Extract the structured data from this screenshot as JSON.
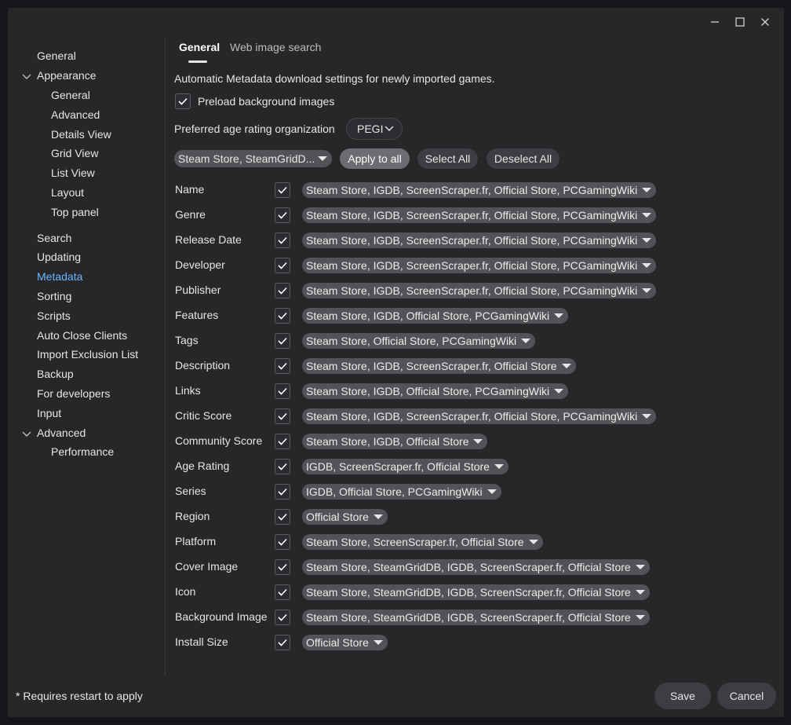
{
  "sidebar": {
    "items": [
      {
        "label": "General",
        "indent": 0
      },
      {
        "label": "Appearance",
        "indent": 0,
        "expanded": true
      },
      {
        "label": "General",
        "indent": 1
      },
      {
        "label": "Advanced",
        "indent": 1
      },
      {
        "label": "Details View",
        "indent": 1
      },
      {
        "label": "Grid View",
        "indent": 1
      },
      {
        "label": "List View",
        "indent": 1
      },
      {
        "label": "Layout",
        "indent": 1
      },
      {
        "label": "Top panel",
        "indent": 1
      },
      {
        "label": "Search",
        "indent": 0
      },
      {
        "label": "Updating",
        "indent": 0
      },
      {
        "label": "Metadata",
        "indent": 0,
        "active": true
      },
      {
        "label": "Sorting",
        "indent": 0
      },
      {
        "label": "Scripts",
        "indent": 0
      },
      {
        "label": "Auto Close Clients",
        "indent": 0
      },
      {
        "label": "Import Exclusion List",
        "indent": 0
      },
      {
        "label": "Backup",
        "indent": 0
      },
      {
        "label": "For developers",
        "indent": 0
      },
      {
        "label": "Input",
        "indent": 0
      },
      {
        "label": "Advanced",
        "indent": 0,
        "expanded": true
      },
      {
        "label": "Performance",
        "indent": 1
      }
    ]
  },
  "tabs": [
    {
      "label": "General",
      "active": true
    },
    {
      "label": "Web image search",
      "active": false
    }
  ],
  "description": "Automatic Metadata download settings for newly imported games.",
  "preload": {
    "label": "Preload background images",
    "checked": true
  },
  "age_rating": {
    "label": "Preferred age rating organization",
    "value": "PEGI"
  },
  "source_selector": {
    "value": "Steam Store, SteamGridD..."
  },
  "buttons": {
    "apply_all": "Apply to all",
    "select_all": "Select All",
    "deselect_all": "Deselect All"
  },
  "fields": [
    {
      "name": "Name",
      "checked": true,
      "sources": "Steam Store, IGDB, ScreenScraper.fr, Official Store, PCGamingWiki"
    },
    {
      "name": "Genre",
      "checked": true,
      "sources": "Steam Store, IGDB, ScreenScraper.fr, Official Store, PCGamingWiki"
    },
    {
      "name": "Release Date",
      "checked": true,
      "sources": "Steam Store, IGDB, ScreenScraper.fr, Official Store, PCGamingWiki"
    },
    {
      "name": "Developer",
      "checked": true,
      "sources": "Steam Store, IGDB, ScreenScraper.fr, Official Store, PCGamingWiki"
    },
    {
      "name": "Publisher",
      "checked": true,
      "sources": "Steam Store, IGDB, ScreenScraper.fr, Official Store, PCGamingWiki"
    },
    {
      "name": "Features",
      "checked": true,
      "sources": "Steam Store, IGDB, Official Store, PCGamingWiki"
    },
    {
      "name": "Tags",
      "checked": true,
      "sources": "Steam Store, Official Store, PCGamingWiki"
    },
    {
      "name": "Description",
      "checked": true,
      "sources": "Steam Store, IGDB, ScreenScraper.fr, Official Store"
    },
    {
      "name": "Links",
      "checked": true,
      "sources": "Steam Store, IGDB, Official Store, PCGamingWiki"
    },
    {
      "name": "Critic Score",
      "checked": true,
      "sources": "Steam Store, IGDB, ScreenScraper.fr, Official Store, PCGamingWiki"
    },
    {
      "name": "Community Score",
      "checked": true,
      "sources": "Steam Store, IGDB, Official Store"
    },
    {
      "name": "Age Rating",
      "checked": true,
      "sources": "IGDB, ScreenScraper.fr, Official Store"
    },
    {
      "name": "Series",
      "checked": true,
      "sources": "IGDB, Official Store, PCGamingWiki"
    },
    {
      "name": "Region",
      "checked": true,
      "sources": "Official Store"
    },
    {
      "name": "Platform",
      "checked": true,
      "sources": "Steam Store, ScreenScraper.fr, Official Store"
    },
    {
      "name": "Cover Image",
      "checked": true,
      "sources": "Steam Store, SteamGridDB, IGDB, ScreenScraper.fr, Official Store"
    },
    {
      "name": "Icon",
      "checked": true,
      "sources": "Steam Store, SteamGridDB, IGDB, ScreenScraper.fr, Official Store"
    },
    {
      "name": "Background Image",
      "checked": true,
      "sources": "Steam Store, SteamGridDB, IGDB, ScreenScraper.fr, Official Store"
    },
    {
      "name": "Install Size",
      "checked": true,
      "sources": "Official Store"
    }
  ],
  "footer": {
    "note": "* Requires restart to apply",
    "save": "Save",
    "cancel": "Cancel"
  }
}
